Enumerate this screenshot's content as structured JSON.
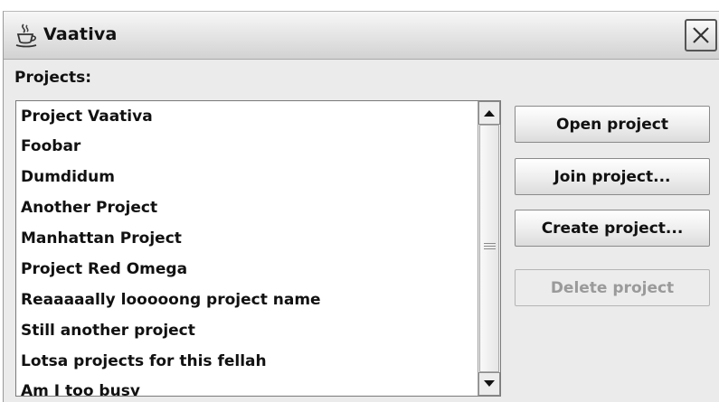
{
  "window": {
    "title": "Vaativa",
    "title_icon": "java-cup-icon",
    "close_icon": "close-icon"
  },
  "projects_label": "Projects:",
  "projects": [
    "Project Vaativa",
    "Foobar",
    "Dumdidum",
    "Another Project",
    "Manhattan Project",
    "Project Red Omega",
    "Reaaaaally looooong project name",
    "Still another project",
    "Lotsa projects for this fellah",
    "Am I too busy"
  ],
  "buttons": {
    "open": "Open project",
    "join": "Join project...",
    "create": "Create project...",
    "delete": "Delete project",
    "delete_enabled": false
  }
}
